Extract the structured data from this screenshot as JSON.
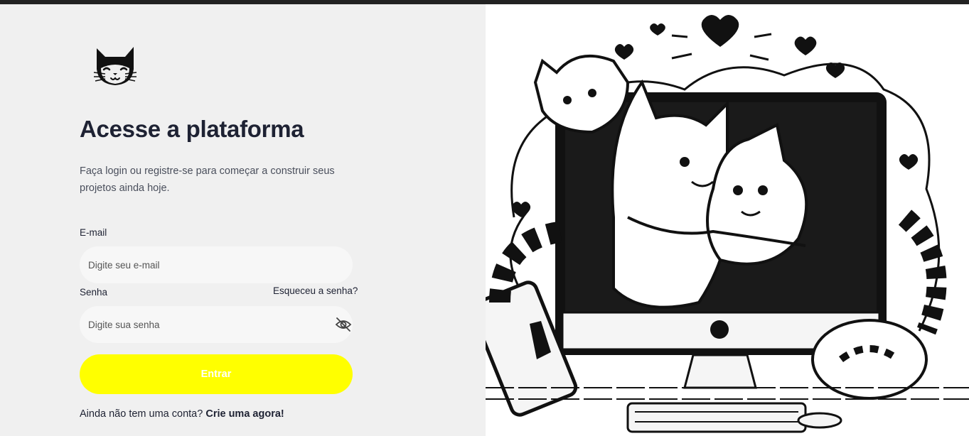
{
  "brand": {
    "logo_icon": "cat-face-icon"
  },
  "login": {
    "title": "Acesse a plataforma",
    "subtitle": "Faça login ou registre-se para começar a construir seus projetos ainda hoje.",
    "email_label": "E-mail",
    "email_placeholder": "Digite seu e-mail",
    "password_label": "Senha",
    "forgot_password": "Esqueceu a senha?",
    "password_placeholder": "Digite sua senha",
    "toggle_visibility_icon": "eye-off-icon",
    "submit_label": "Entrar",
    "signup_prompt": "Ainda não tem uma conta?",
    "signup_link": "Crie uma agora!"
  },
  "colors": {
    "primary_button": "#ffff00",
    "text_dark": "#1e2233",
    "panel_bg": "#f0f0f0",
    "input_bg": "#f7f7f7"
  },
  "illustration": {
    "subject": "cats-hugging-computer-illustration"
  }
}
